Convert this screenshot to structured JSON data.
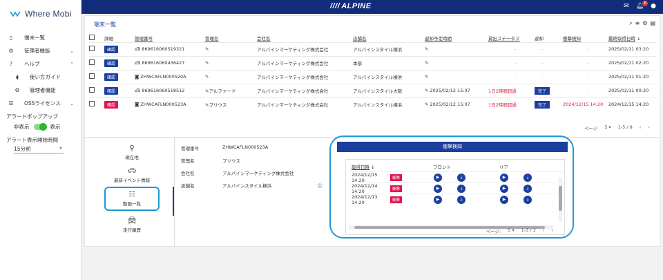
{
  "app": {
    "logo": "Where Mobi",
    "brand": "ALPINE",
    "notification_count": "6"
  },
  "sidebar": {
    "items": [
      {
        "label": "端末一覧",
        "icon": "phone-icon"
      },
      {
        "label": "管理者機能",
        "icon": "gear-icon"
      },
      {
        "label": "ヘルプ",
        "icon": "help-icon"
      },
      {
        "label": "使い方ガイド",
        "icon": "mouse-icon"
      },
      {
        "label": "管理者機能",
        "icon": "gear-icon"
      },
      {
        "label": "OSSライセンス",
        "icon": "list-icon"
      }
    ],
    "alert_popup_label": "アラートポップアップ",
    "toggle_off": "非表示",
    "toggle_on": "表示",
    "alert_start_label": "アラート表示開始時間",
    "alert_start_value": "15分前"
  },
  "main": {
    "title": "端末一覧",
    "columns": [
      "詳細",
      "管理番号",
      "管理名",
      "会社名",
      "店舗名",
      "返却予定時間",
      "貸出ステータス",
      "返却",
      "衝撃検知",
      "最終取得日時"
    ],
    "rows": [
      {
        "btn": "確認",
        "red": false,
        "id": "869616060519321",
        "idicon": "car",
        "name": "",
        "company": "アルパインマーケティング株式会社",
        "store": "アルパインスタイル横浜",
        "ret_time": "",
        "status": "-",
        "ret": "-",
        "impact": "-",
        "last": "2025/02/11 03:20"
      },
      {
        "btn": "確認",
        "red": false,
        "id": "869616060436427",
        "idicon": "car",
        "name": "",
        "company": "アルパインマーケティング株式会社",
        "store": "本部",
        "ret_time": "",
        "status": "-",
        "ret": "-",
        "impact": "-",
        "last": "2025/02/11 02:20"
      },
      {
        "btn": "確認",
        "red": false,
        "id": "ZHWCAFLN000520A",
        "idicon": "cam",
        "name": "",
        "company": "アルパインマーケティング株式会社",
        "store": "アルパインスタイル横浜",
        "ret_time": "",
        "status": "-",
        "ret": "-",
        "impact": "-",
        "last": "2025/02/11 01:20"
      },
      {
        "btn": "確認",
        "red": false,
        "id": "869616060518512",
        "idicon": "car",
        "name": "アルファード",
        "company": "アルパインマーケティング株式会社",
        "store": "アルパインスタイル大阪",
        "ret_time": "2025/02/12 15:07",
        "status": "1日2時間超過",
        "ret": "完了",
        "impact": "-",
        "last": "2025/02/11 00:20"
      },
      {
        "btn": "確認",
        "red": true,
        "id": "ZHWCAFLN000523A",
        "idicon": "cam",
        "name": "プリウス",
        "company": "アルパインマーケティング株式会社",
        "store": "アルパインスタイル横浜",
        "ret_time": "2025/02/12 15:07",
        "status": "1日2時間超過",
        "ret": "完了",
        "impact": "2024/12/15 14:20",
        "last": "2024/12/15 14:20"
      }
    ],
    "pager": {
      "label": "ページ",
      "size": "5",
      "range": "1-5 / 8"
    }
  },
  "detail": {
    "tabs": [
      "現在地",
      "最新イベント情報",
      "動画一覧",
      "走行履歴"
    ],
    "fields": [
      {
        "k": "管理番号",
        "v": "ZHWCAFLN000523A"
      },
      {
        "k": "管理名",
        "v": "プリウス"
      },
      {
        "k": "会社名",
        "v": "アルパインマーケティング株式会社"
      },
      {
        "k": "店舗名",
        "v": "アルパインスタイル横浜"
      }
    ],
    "marker": "①",
    "impact": {
      "title": "衝撃検知",
      "col_date": "取得日時",
      "col_front": "フロント",
      "col_rear": "リア",
      "rows": [
        {
          "date": "2024/12/15 14:20",
          "tag": "衝撃"
        },
        {
          "date": "2024/12/14 14:20",
          "tag": "衝撃"
        },
        {
          "date": "2024/12/13 14:20",
          "tag": "衝撃"
        }
      ],
      "pager": {
        "label": "ページ:",
        "size": "5",
        "range": "1-3 / 3"
      }
    }
  }
}
